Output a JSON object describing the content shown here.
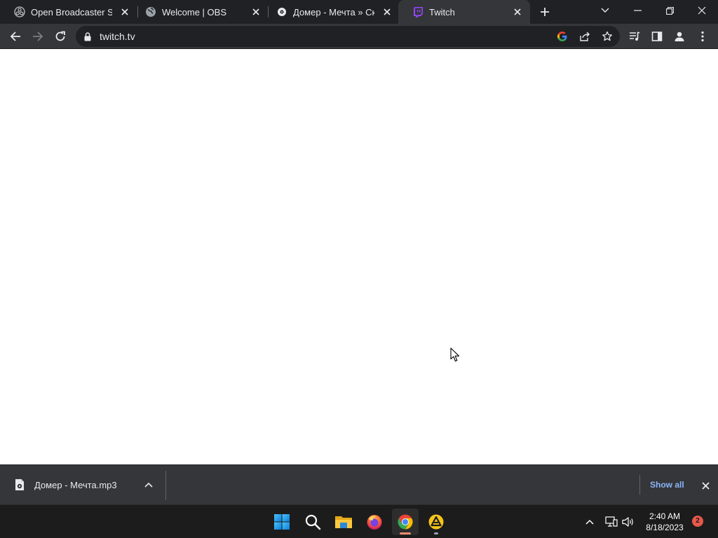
{
  "browser": {
    "tabs": [
      {
        "title": "Open Broadcaster Software",
        "icon": "obs-icon"
      },
      {
        "title": "Welcome | OBS",
        "icon": "globe-icon"
      },
      {
        "title": "Домер - Мечта » Скачать",
        "icon": "music-site-icon"
      },
      {
        "title": "Twitch",
        "icon": "twitch-icon",
        "active": true
      }
    ],
    "address_bar": {
      "url": "twitch.tv"
    }
  },
  "download_shelf": {
    "items": [
      {
        "filename": "Домер - Мечта.mp3"
      }
    ],
    "show_all_label": "Show all"
  },
  "taskbar": {
    "apps": [
      "start",
      "search",
      "file-explorer",
      "firefox",
      "chrome",
      "game-launcher"
    ],
    "clock": {
      "time": "2:40 AM",
      "date": "8/18/2023"
    },
    "notifications_count": "2"
  },
  "colors": {
    "tab_strip": "#202124",
    "toolbar": "#35363a",
    "link": "#8ab4f8",
    "taskbar": "#1c1c1c",
    "chrome_indicator": "#f28b6d",
    "notification_badge": "#e8584a"
  }
}
